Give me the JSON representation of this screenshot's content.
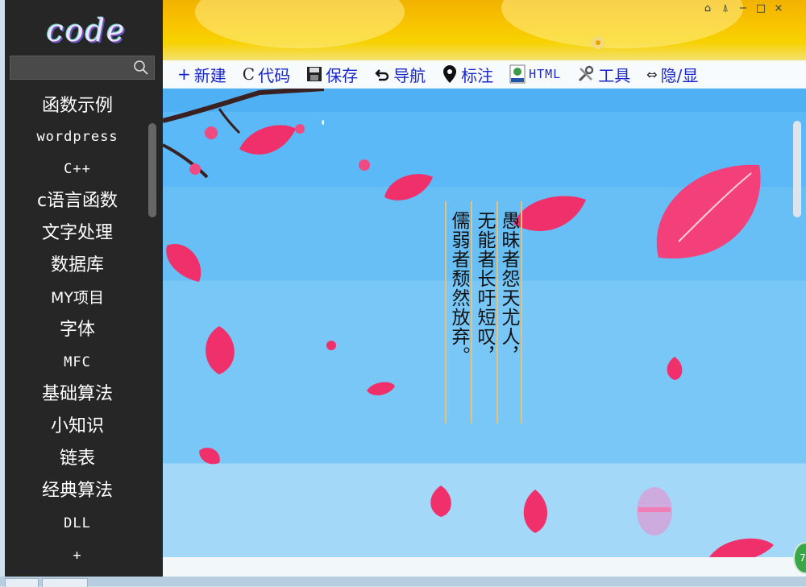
{
  "sidebar": {
    "logo_text": "code",
    "search": {
      "value": "",
      "placeholder": ""
    },
    "items": [
      {
        "label": "函数示例"
      },
      {
        "label": "wordpress"
      },
      {
        "label": "C++"
      },
      {
        "label": "c语言函数"
      },
      {
        "label": "文字处理"
      },
      {
        "label": "数据库"
      },
      {
        "label": "MY项目"
      },
      {
        "label": "字体"
      },
      {
        "label": "MFC"
      },
      {
        "label": "基础算法"
      },
      {
        "label": "小知识"
      },
      {
        "label": "链表"
      },
      {
        "label": "经典算法"
      },
      {
        "label": "DLL"
      },
      {
        "label": "+"
      }
    ]
  },
  "window_controls": [
    "home-icon",
    "pin-icon",
    "minimize-icon",
    "maximize-icon",
    "close-icon"
  ],
  "toolbar": {
    "new_label": "新建",
    "code_label": "代码",
    "save_label": "保存",
    "nav_label": "导航",
    "mark_label": "标注",
    "html_label": "HTML",
    "tools_label": "工具",
    "toggle_label": "隐/显"
  },
  "poem": {
    "lines": [
      "愚昧者怨天尤人，",
      "无能者长吁短叹，",
      "儒弱者颓然放弃。"
    ]
  },
  "badge_text": "7",
  "colors": {
    "sidebar_bg": "#262626",
    "toolbar_text": "#1a27c8",
    "banner_yellow": "#f8c400",
    "canvas_blue": "#67bff6",
    "petal_pink": "#f0306a"
  }
}
